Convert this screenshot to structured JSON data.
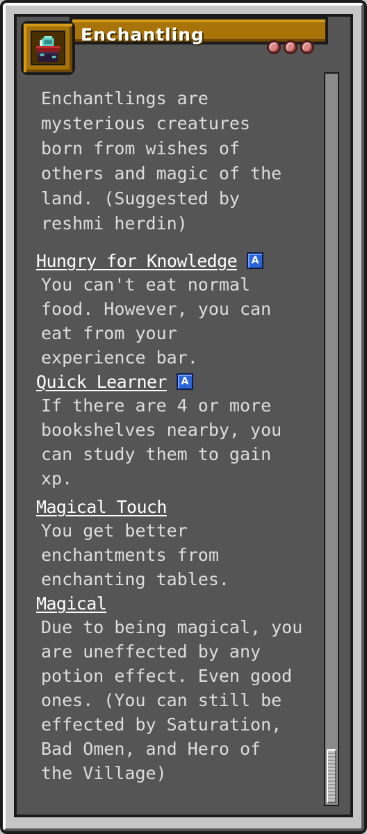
{
  "origin": {
    "name": "Enchantling",
    "icon": "enchanting-table-icon",
    "impact_count": 3,
    "description": "Enchantlings are\nmysterious creatures\nborn from wishes of\nothers and magic of the\nland. (Suggested by\nreshmi herdin)"
  },
  "powers": [
    {
      "name": "Hungry for Knowledge",
      "badge": "A",
      "description": "You can't eat normal\nfood. However, you can\neat from your\nexperience bar."
    },
    {
      "name": "Quick Learner",
      "badge": "A",
      "description": "If there are 4 or more\nbookshelves nearby, you\ncan study them to gain\nxp."
    },
    {
      "name": "Magical Touch",
      "badge": "",
      "description": "You get better\nenchantments from\nenchanting tables."
    },
    {
      "name": "Magical",
      "badge": "",
      "description": "Due to being magical, you\nare uneffected by any\npotion effect. Even good\nones. (You can still be\neffected by Saturation,\nBad Omen, and Hero of\nthe Village)"
    }
  ],
  "colors": {
    "panel": "#555555",
    "title_bar": "#a8740a",
    "impact_dot": "#d98888",
    "active_badge": "#2b64d6"
  }
}
